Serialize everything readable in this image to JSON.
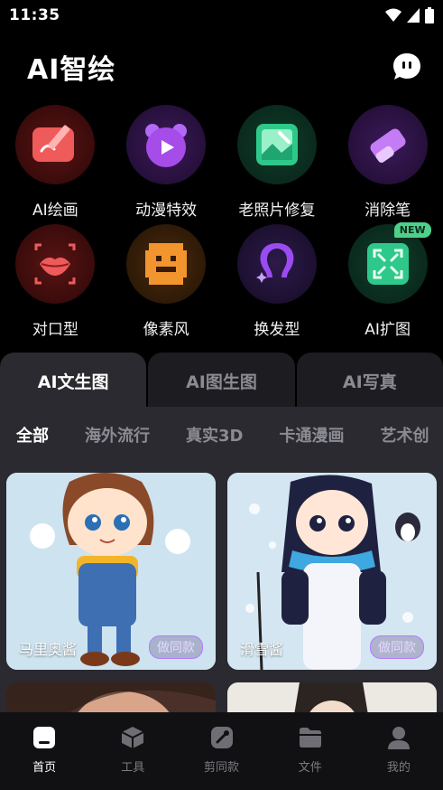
{
  "status": {
    "time": "11:35"
  },
  "header": {
    "title": "AI智绘",
    "chat_icon": "chat-bubble-icon"
  },
  "tools": [
    {
      "label": "AI绘画",
      "icon": "paint-board-icon",
      "color": "#e8474c"
    },
    {
      "label": "动漫特效",
      "icon": "anime-bear-icon",
      "color": "#a64ce8"
    },
    {
      "label": "老照片修复",
      "icon": "photo-repair-icon",
      "color": "#2ec98a"
    },
    {
      "label": "消除笔",
      "icon": "eraser-icon",
      "color": "#b25cf0"
    },
    {
      "label": "对口型",
      "icon": "lips-icon",
      "color": "#e8474c"
    },
    {
      "label": "像素风",
      "icon": "pixel-face-icon",
      "color": "#f2952f"
    },
    {
      "label": "换发型",
      "icon": "hair-icon",
      "color": "#9a4cf0"
    },
    {
      "label": "AI扩图",
      "icon": "expand-icon",
      "color": "#2ec98a",
      "badge": "NEW"
    }
  ],
  "main_tabs": [
    {
      "label": "AI文生图",
      "active": true
    },
    {
      "label": "AI图生图",
      "active": false
    },
    {
      "label": "AI写真",
      "active": false
    }
  ],
  "categories": [
    {
      "label": "全部",
      "active": true
    },
    {
      "label": "海外流行"
    },
    {
      "label": "真实3D"
    },
    {
      "label": "卡通漫画"
    },
    {
      "label": "艺术创"
    }
  ],
  "cards": [
    {
      "name": "马里奥酱",
      "button": "做同款"
    },
    {
      "name": "滑雪酱",
      "button": "做同款"
    }
  ],
  "nav": [
    {
      "label": "首页",
      "icon": "home-icon",
      "active": true
    },
    {
      "label": "工具",
      "icon": "tools-cube-icon"
    },
    {
      "label": "剪同款",
      "icon": "clip-icon"
    },
    {
      "label": "文件",
      "icon": "folder-icon"
    },
    {
      "label": "我的",
      "icon": "profile-icon"
    }
  ]
}
